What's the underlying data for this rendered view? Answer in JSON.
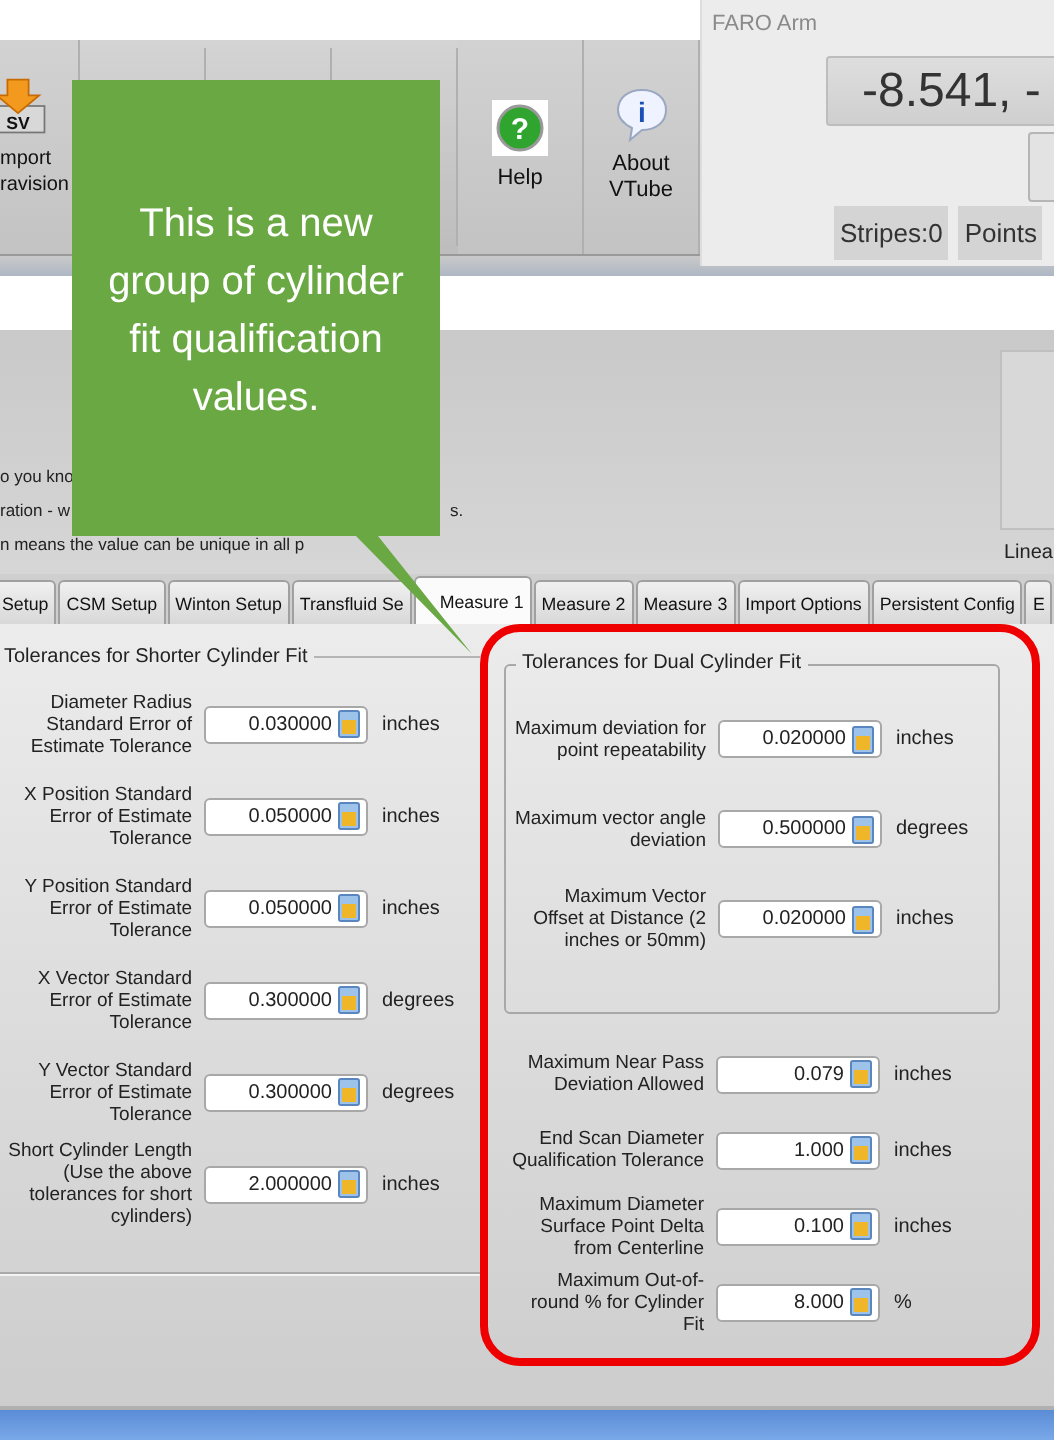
{
  "toolbar": {
    "buttons": [
      {
        "kind": "import",
        "glyph": "SV",
        "lines": [
          "mport",
          "ravision"
        ]
      },
      {
        "kind": "help",
        "glyph": "?",
        "lines": [
          "Help"
        ]
      },
      {
        "kind": "about",
        "glyph": "i",
        "lines": [
          "About",
          "VTube"
        ]
      }
    ]
  },
  "instrument_window": {
    "title": "FARO Arm",
    "readout": "-8.541, -",
    "stripes": "Stripes:0",
    "points": "Points"
  },
  "notes": [
    {
      "parts": [
        "o you kno"
      ]
    },
    {
      "parts": [
        "ration - w",
        "s."
      ]
    },
    {
      "parts": [
        "n means the value can be unique in all p"
      ]
    }
  ],
  "side_panel": {
    "label": "Linea"
  },
  "tabs": [
    {
      "label": "Setup",
      "selected": false
    },
    {
      "label": "CSM Setup",
      "selected": false
    },
    {
      "label": "Winton Setup",
      "selected": false
    },
    {
      "label": "Transfluid Se",
      "selected": false
    },
    {
      "label": "Measure 1",
      "selected": true
    },
    {
      "label": "Measure 2",
      "selected": false
    },
    {
      "label": "Measure 3",
      "selected": false
    },
    {
      "label": "Import Options",
      "selected": false
    },
    {
      "label": "Persistent Config",
      "selected": false
    },
    {
      "label": "E",
      "selected": false
    }
  ],
  "shorter_cylinder_group": {
    "title": "Tolerances for Shorter Cylinder Fit",
    "fields": [
      {
        "label": "Diameter Radius Standard Error of Estimate Tolerance",
        "value": "0.030000",
        "unit": "inches"
      },
      {
        "label": "X Position Standard Error of Estimate Tolerance",
        "value": "0.050000",
        "unit": "inches"
      },
      {
        "label": "Y Position Standard Error of Estimate Tolerance",
        "value": "0.050000",
        "unit": "inches"
      },
      {
        "label": "X Vector Standard Error of Estimate Tolerance",
        "value": "0.300000",
        "unit": "degrees"
      },
      {
        "label": "Y Vector Standard Error of Estimate Tolerance",
        "value": "0.300000",
        "unit": "degrees"
      },
      {
        "label": "Short Cylinder Length (Use the above tolerances for short cylinders)",
        "value": "2.000000",
        "unit": "inches"
      }
    ]
  },
  "dual_cylinder_group": {
    "title": "Tolerances for Dual Cylinder Fit",
    "fields": [
      {
        "label": "Maximum deviation for point repeatability",
        "value": "0.020000",
        "unit": "inches"
      },
      {
        "label": "Maximum vector angle deviation",
        "value": "0.500000",
        "unit": "degrees"
      },
      {
        "label": "Maximum Vector Offset at Distance (2 inches or 50mm)",
        "value": "0.020000",
        "unit": "inches"
      }
    ]
  },
  "more_fields": [
    {
      "label": "Maximum Near Pass Deviation Allowed",
      "value": "0.079",
      "unit": "inches"
    },
    {
      "label": "End Scan Diameter Qualification Tolerance",
      "value": "1.000",
      "unit": "inches"
    },
    {
      "label": "Maximum Diameter Surface Point Delta from Centerline",
      "value": "0.100",
      "unit": "inches"
    },
    {
      "label": "Maximum Out-of-round % for Cylinder Fit",
      "value": "8.000",
      "unit": "%"
    }
  ],
  "callout": {
    "text": "This is a new group of cylinder fit qualification values."
  }
}
